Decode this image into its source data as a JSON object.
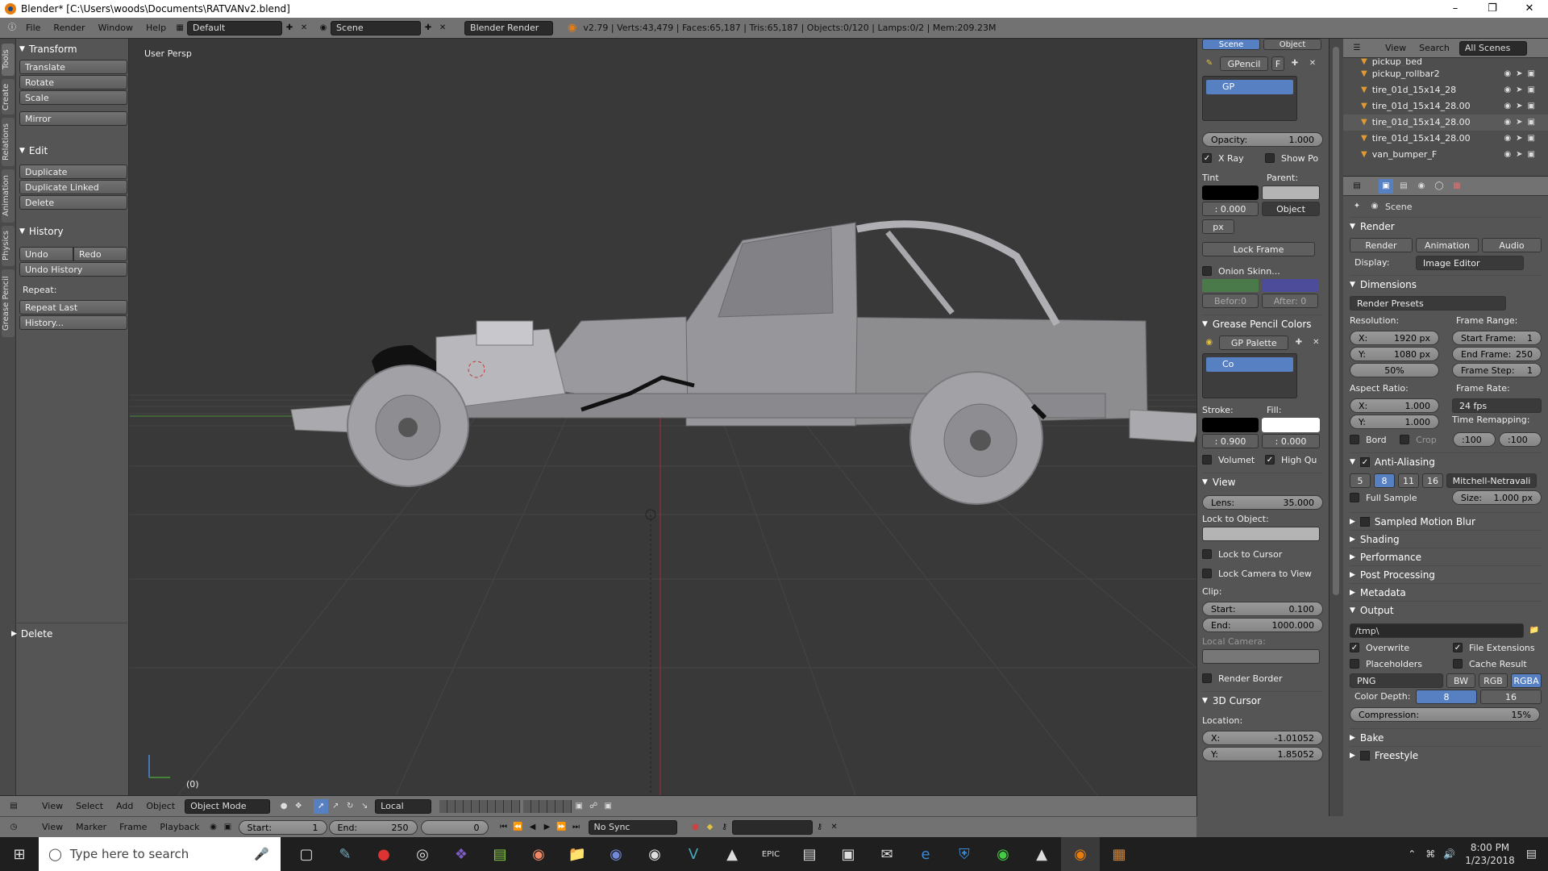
{
  "window": {
    "title": "Blender* [C:\\Users\\woods\\Documents\\RATVANv2.blend]"
  },
  "infobar": {
    "menus": [
      "File",
      "Render",
      "Window",
      "Help"
    ],
    "layout": "Default",
    "scene": "Scene",
    "engine": "Blender Render",
    "stats": "v2.79 | Verts:43,479 | Faces:65,187 | Tris:65,187 | Objects:0/120 | Lamps:0/2 | Mem:209.23M"
  },
  "toolshelf": {
    "tabs": [
      "Tools",
      "Create",
      "Relations",
      "Animation",
      "Physics",
      "Grease Pencil"
    ],
    "transform": {
      "title": "Transform",
      "buttons": [
        "Translate",
        "Rotate",
        "Scale",
        "Mirror"
      ]
    },
    "edit": {
      "title": "Edit",
      "buttons": [
        "Duplicate",
        "Duplicate Linked",
        "Delete"
      ]
    },
    "history": {
      "title": "History",
      "undo": "Undo",
      "redo": "Redo",
      "undo_history": "Undo History",
      "repeat_label": "Repeat:",
      "repeat_last": "Repeat Last",
      "history_btn": "History..."
    },
    "operator": "Delete"
  },
  "viewport": {
    "label": "User Persp",
    "frame": "(0)"
  },
  "npanel": {
    "tabs": [
      "Scene",
      "Object"
    ],
    "gpencil": "GPencil",
    "gp_layer": "GP",
    "opacity": {
      "label": "Opacity:",
      "value": "1.000"
    },
    "xray": "X Ray",
    "show_po": "Show Po",
    "tint_label": "Tint",
    "parent_label": "Parent:",
    "tint_value": ": 0.000",
    "parent_type": "Object",
    "px": "px",
    "lock_frame": "Lock Frame",
    "onion": "Onion Skinn...",
    "before": "Befor:0",
    "after": "After: 0",
    "colors_title": "Grease Pencil Colors",
    "palette": "GP Palette",
    "palette_color": "Co",
    "stroke_label": "Stroke:",
    "fill_label": "Fill:",
    "stroke_value": ": 0.900",
    "fill_value": ": 0.000",
    "volumet": "Volumet",
    "high_qu": "High Qu",
    "view_title": "View",
    "lens": {
      "label": "Lens:",
      "value": "35.000"
    },
    "lock_object": "Lock to Object:",
    "lock_cursor": "Lock to Cursor",
    "lock_camera": "Lock Camera to View",
    "clip": "Clip:",
    "clip_start": {
      "label": "Start:",
      "value": "0.100"
    },
    "clip_end": {
      "label": "End:",
      "value": "1000.000"
    },
    "local_camera": "Local Camera:",
    "render_border": "Render Border",
    "cursor_title": "3D Cursor",
    "location": "Location:",
    "cursor_x": {
      "label": "X:",
      "value": "-1.01052"
    },
    "cursor_y": {
      "label": "Y:",
      "value": "1.85052"
    }
  },
  "outliner": {
    "menus": [
      "View",
      "Search"
    ],
    "filter": "All Scenes",
    "items": [
      "pickup_bed",
      "pickup_rollbar2",
      "tire_01d_15x14_28",
      "tire_01d_15x14_28.00",
      "tire_01d_15x14_28.00",
      "tire_01d_15x14_28.00",
      "van_bumper_F"
    ]
  },
  "properties": {
    "context": "Scene",
    "render_title": "Render",
    "render_btn": "Render",
    "animation_btn": "Animation",
    "audio_btn": "Audio",
    "display_label": "Display:",
    "display_value": "Image Editor",
    "dimensions_title": "Dimensions",
    "presets": "Render Presets",
    "resolution_label": "Resolution:",
    "frame_range_label": "Frame Range:",
    "res_x": {
      "label": "X:",
      "value": "1920 px"
    },
    "res_y": {
      "label": "Y:",
      "value": "1080 px"
    },
    "res_pct": "50%",
    "start_frame": {
      "label": "Start Frame:",
      "value": "1"
    },
    "end_frame": {
      "label": "End Frame:",
      "value": "250"
    },
    "frame_step": {
      "label": "Frame Step:",
      "value": "1"
    },
    "aspect_label": "Aspect Ratio:",
    "frame_rate_label": "Frame Rate:",
    "asp_x": {
      "label": "X:",
      "value": "1.000"
    },
    "asp_y": {
      "label": "Y:",
      "value": "1.000"
    },
    "fps": "24 fps",
    "time_remap": "Time Remapping:",
    "bord": "Bord",
    "crop": "Crop",
    "remap_old": ":100",
    "remap_new": ":100",
    "aa_title": "Anti-Aliasing",
    "aa_samples": [
      "5",
      "8",
      "11",
      "16"
    ],
    "aa_filter": "Mitchell-Netravali",
    "full_sample": "Full Sample",
    "size": {
      "label": "Size:",
      "value": "1.000 px"
    },
    "sections": [
      "Sampled Motion Blur",
      "Shading",
      "Performance",
      "Post Processing",
      "Metadata"
    ],
    "output_title": "Output",
    "output_path": "/tmp\\",
    "overwrite": "Overwrite",
    "file_ext": "File Extensions",
    "placeholders": "Placeholders",
    "cache_result": "Cache Result",
    "format": "PNG",
    "color_modes": [
      "BW",
      "RGB",
      "RGBA"
    ],
    "color_depth_label": "Color Depth:",
    "depth_8": "8",
    "depth_16": "16",
    "compression": "Compression:",
    "compression_value": "15%",
    "bake": "Bake",
    "freestyle": "Freestyle"
  },
  "view3d_header": {
    "menus": [
      "View",
      "Select",
      "Add",
      "Object"
    ],
    "mode": "Object Mode",
    "orientation": "Local"
  },
  "timeline": {
    "menus": [
      "View",
      "Marker",
      "Frame",
      "Playback"
    ],
    "start": {
      "label": "Start:",
      "value": "1"
    },
    "end": {
      "label": "End:",
      "value": "250"
    },
    "current": "0",
    "sync": "No Sync"
  },
  "taskbar": {
    "search_placeholder": "Type here to search",
    "time": "8:00 PM",
    "date": "1/23/2018"
  },
  "colors": {
    "accent_blue": "#5680c2",
    "blender_orange": "#e87d0d"
  }
}
